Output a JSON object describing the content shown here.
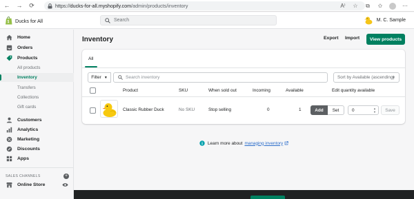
{
  "browser": {
    "url_scheme": "https://",
    "url_host": "ducks-for-all.myshopify.com",
    "url_path": "/admin/products/inventory"
  },
  "topbar": {
    "store_name": "Ducks for All",
    "search_placeholder": "Search",
    "user_name": "M. C. Sample"
  },
  "sidebar": {
    "items": [
      {
        "label": "Home",
        "icon": "home-icon"
      },
      {
        "label": "Orders",
        "icon": "orders-icon"
      },
      {
        "label": "Products",
        "icon": "tag-icon"
      }
    ],
    "product_subitems": [
      {
        "label": "All products"
      },
      {
        "label": "Inventory",
        "active": true
      },
      {
        "label": "Transfers"
      },
      {
        "label": "Collections"
      },
      {
        "label": "Gift cards"
      }
    ],
    "items2": [
      {
        "label": "Customers",
        "icon": "person-icon"
      },
      {
        "label": "Analytics",
        "icon": "analytics-icon"
      },
      {
        "label": "Marketing",
        "icon": "marketing-icon"
      },
      {
        "label": "Discounts",
        "icon": "discount-icon"
      },
      {
        "label": "Apps",
        "icon": "apps-icon"
      }
    ],
    "sales_channels_label": "SALES CHANNELS",
    "online_store": "Online Store"
  },
  "page": {
    "title": "Inventory",
    "export": "Export",
    "import": "Import",
    "view_products": "View products"
  },
  "card": {
    "tab_all": "All",
    "filter": "Filter",
    "search_placeholder": "Search inventory",
    "sort": "Sort by Available (ascending)",
    "columns": {
      "product": "Product",
      "sku": "SKU",
      "when_sold_out": "When sold out",
      "incoming": "Incoming",
      "available": "Available",
      "edit_qty": "Edit quantity available"
    },
    "row": {
      "product": "Classic Rubber Duck",
      "sku": "No SKU",
      "when_sold_out": "Stop selling",
      "incoming": "0",
      "available": "1",
      "add": "Add",
      "set": "Set",
      "qty": "0",
      "save": "Save"
    }
  },
  "learn_more": {
    "prefix": "Learn more about",
    "link": "managing inventory"
  },
  "colors": {
    "accent": "#008060",
    "link": "#2c6ecb",
    "dark": "#202223"
  }
}
